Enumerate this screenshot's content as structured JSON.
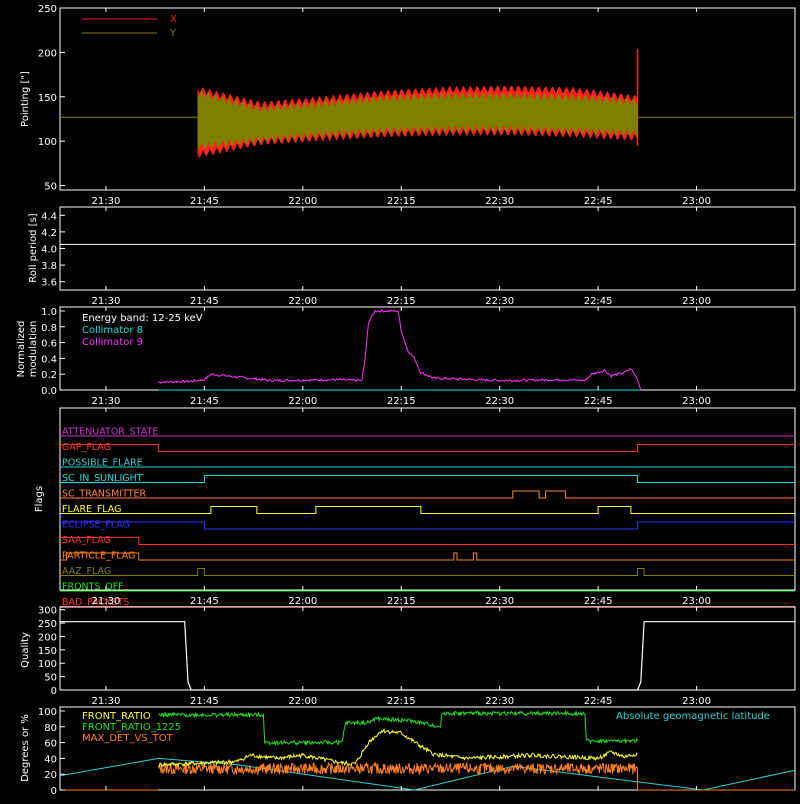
{
  "time_ticks": [
    "21:30",
    "21:45",
    "22:00",
    "22:15",
    "22:30",
    "22:45",
    "23:00"
  ],
  "time_tick_minutes": [
    1290,
    1305,
    1320,
    1335,
    1350,
    1365,
    1380
  ],
  "time_range_minutes": [
    1283,
    1395
  ],
  "colors": {
    "axis": "#ffffff",
    "x": "#ff2020",
    "y": "#808000",
    "coll8": "#00e0e0",
    "coll9": "#ff30ff",
    "front_ratio": "#ffff30",
    "front_ratio_1225": "#20e020",
    "max_det": "#ff8020",
    "geomag": "#30d0d0"
  },
  "chart_data": [
    {
      "type": "line",
      "id": "pointing",
      "ylabel": "Pointing [\"]",
      "yticks": [
        "250",
        "200",
        "150",
        "100",
        "50"
      ],
      "ytick_values": [
        250,
        200,
        150,
        100,
        50
      ],
      "ylim": [
        45,
        250
      ],
      "series": [
        {
          "name": "X",
          "color": "#ff2020",
          "start": 1304,
          "end": 1371,
          "env_low": [
            81,
            95,
            100,
            104,
            106,
            106,
            104,
            100
          ],
          "env_high": [
            162,
            145,
            151,
            158,
            162,
            163,
            161,
            152
          ],
          "spike": 204
        },
        {
          "name": "Y",
          "color": "#808000",
          "start": 1304,
          "end": 1371,
          "env_low": [
            90,
            98,
            104,
            108,
            110,
            110,
            108,
            105
          ],
          "env_high": [
            158,
            140,
            146,
            152,
            155,
            155,
            153,
            148
          ],
          "baseline": 127
        }
      ]
    },
    {
      "type": "line",
      "id": "roll",
      "ylabel": "Roll period [s]",
      "yticks": [
        "4.4",
        "4.2",
        "4.0",
        "3.8",
        "3.6"
      ],
      "ytick_values": [
        4.4,
        4.2,
        4.0,
        3.8,
        3.6
      ],
      "ylim": [
        3.5,
        4.5
      ],
      "series": [
        {
          "name": "",
          "color": "#ffffff",
          "value": 4.05
        }
      ]
    },
    {
      "type": "line",
      "id": "modulation",
      "ylabel": "Normalized modulation",
      "ylabel_lines": [
        "Normalized",
        "modulation"
      ],
      "yticks": [
        "1.0",
        "0.8",
        "0.6",
        "0.4",
        "0.2",
        "0.0"
      ],
      "ytick_values": [
        1.0,
        0.8,
        0.6,
        0.4,
        0.2,
        0.0
      ],
      "ylim": [
        0,
        1.05
      ],
      "legend": [
        "Energy band: 12-25 keV",
        "Collimator 8",
        "Collimator 9"
      ],
      "series": [
        {
          "name": "Collimator 8",
          "color": "#00e0e0",
          "value": 0.0
        },
        {
          "name": "Collimator 9",
          "color": "#ff30ff",
          "x": [
            1298,
            1303,
            1305,
            1306,
            1315,
            1325,
            1329,
            1329.5,
            1330,
            1331,
            1332,
            1334,
            1334.5,
            1335,
            1336,
            1337,
            1338,
            1340,
            1350,
            1360,
            1363,
            1364,
            1366,
            1367,
            1369,
            1370,
            1371,
            1371.5
          ],
          "y": [
            0.1,
            0.11,
            0.13,
            0.2,
            0.12,
            0.13,
            0.12,
            0.4,
            0.85,
            1.0,
            1.0,
            1.0,
            1.0,
            0.75,
            0.5,
            0.4,
            0.22,
            0.15,
            0.12,
            0.13,
            0.12,
            0.2,
            0.25,
            0.18,
            0.22,
            0.27,
            0.14,
            0.0
          ]
        }
      ]
    },
    {
      "type": "line",
      "id": "flags",
      "ylabel": "Flags",
      "flags": [
        {
          "name": "ATTENUATOR_STATE",
          "color": "#d030d0",
          "segments": [
            [
              1283,
              1395,
              0
            ]
          ]
        },
        {
          "name": "GAP_FLAG",
          "color": "#ff3030",
          "segments": [
            [
              1283,
              1298,
              1
            ],
            [
              1298,
              1371,
              0
            ],
            [
              1371,
              1395,
              1
            ]
          ]
        },
        {
          "name": "POSSIBLE_FLARE",
          "color": "#30d0d0",
          "segments": [
            [
              1283,
              1395,
              0
            ]
          ]
        },
        {
          "name": "SC_IN_SUNLIGHT",
          "color": "#00e0e0",
          "segments": [
            [
              1283,
              1305,
              0
            ],
            [
              1305,
              1371,
              1
            ],
            [
              1371,
              1395,
              0
            ]
          ]
        },
        {
          "name": "SC_TRANSMITTER",
          "color": "#ff8040",
          "segments": [
            [
              1283,
              1352,
              0
            ],
            [
              1352,
              1356,
              1
            ],
            [
              1356,
              1357,
              0
            ],
            [
              1357,
              1360,
              1
            ],
            [
              1360,
              1395,
              0
            ]
          ]
        },
        {
          "name": "FLARE_FLAG",
          "color": "#ffff30",
          "segments": [
            [
              1283,
              1306,
              0
            ],
            [
              1306,
              1313,
              1
            ],
            [
              1313,
              1322,
              0
            ],
            [
              1322,
              1338,
              1
            ],
            [
              1338,
              1365,
              0
            ],
            [
              1365,
              1370,
              1
            ],
            [
              1370,
              1395,
              0
            ]
          ]
        },
        {
          "name": "ECLIPSE_FLAG",
          "color": "#3030ff",
          "segments": [
            [
              1283,
              1305,
              1
            ],
            [
              1305,
              1371,
              0
            ],
            [
              1371,
              1395,
              1
            ]
          ]
        },
        {
          "name": "SAA_FLAG",
          "color": "#ff3030",
          "segments": [
            [
              1283,
              1295,
              1
            ],
            [
              1295,
              1395,
              0
            ]
          ]
        },
        {
          "name": "PARTICLE_FLAG",
          "color": "#ff8020",
          "segments": [
            [
              1283,
              1284,
              0
            ],
            [
              1284,
              1295,
              1
            ],
            [
              1295,
              1343,
              0
            ],
            [
              1343,
              1343.5,
              1
            ],
            [
              1343.5,
              1346,
              0
            ],
            [
              1346,
              1346.5,
              1
            ],
            [
              1346.5,
              1395,
              0
            ]
          ]
        },
        {
          "name": "AAZ_FLAG",
          "color": "#808000",
          "segments": [
            [
              1283,
              1304,
              0
            ],
            [
              1304,
              1305,
              1
            ],
            [
              1305,
              1371,
              0
            ],
            [
              1371,
              1372,
              1
            ],
            [
              1372,
              1395,
              0
            ]
          ]
        },
        {
          "name": "FRONTS_OFF",
          "color": "#20e020",
          "segments": [
            [
              1283,
              1395,
              0
            ]
          ]
        },
        {
          "name": "BAD_PACKETS",
          "color": "#ff3030",
          "segments": [
            [
              1283,
              1395,
              0
            ]
          ]
        }
      ]
    },
    {
      "type": "line",
      "id": "quality",
      "ylabel": "Quality",
      "yticks": [
        "300",
        "250",
        "200",
        "150",
        "100",
        "50",
        "0"
      ],
      "ytick_values": [
        300,
        250,
        200,
        150,
        100,
        50,
        0
      ],
      "ylim": [
        0,
        310
      ],
      "series": [
        {
          "name": "",
          "color": "#ffffff",
          "x": [
            1283,
            1302,
            1302.5,
            1303,
            1371,
            1371.5,
            1372,
            1395
          ],
          "y": [
            255,
            255,
            30,
            0,
            0,
            30,
            255,
            255
          ]
        }
      ]
    },
    {
      "type": "line",
      "id": "ratios",
      "ylabel": "Degrees or %",
      "yticks": [
        "100",
        "80",
        "60",
        "40",
        "20",
        "0"
      ],
      "ytick_values": [
        100,
        80,
        60,
        40,
        20,
        0
      ],
      "ylim": [
        0,
        105
      ],
      "legend": [
        "FRONT_RATIO",
        "FRONT_RATIO_1225",
        "MAX_DET_VS_TOT",
        "Absolute geomagnetic latitude"
      ],
      "series": [
        {
          "name": "FRONT_RATIO",
          "color": "#ffff30",
          "x": [
            1298,
            1305,
            1310,
            1312,
            1316,
            1320,
            1326,
            1328,
            1330,
            1332,
            1335,
            1338,
            1340,
            1345,
            1355,
            1365,
            1367,
            1369,
            1371
          ],
          "y": [
            32,
            34,
            36,
            44,
            40,
            44,
            34,
            33,
            60,
            75,
            72,
            55,
            45,
            40,
            44,
            40,
            48,
            42,
            46
          ]
        },
        {
          "name": "FRONT_RATIO_1225",
          "color": "#20e020",
          "x": [
            1298,
            1314,
            1314.2,
            1326,
            1326.5,
            1330,
            1331,
            1336,
            1338,
            1341,
            1341.2,
            1363,
            1363.2,
            1371
          ],
          "y": [
            95,
            95,
            60,
            60,
            85,
            85,
            90,
            88,
            85,
            80,
            97,
            97,
            62,
            62
          ]
        },
        {
          "name": "MAX_DET_VS_TOT",
          "color": "#ff8020",
          "value": 27
        },
        {
          "name": "Absolute geomagnetic latitude",
          "color": "#30d0d0",
          "x": [
            1283,
            1298,
            1310,
            1337,
            1352,
            1381,
            1395
          ],
          "y": [
            18,
            40,
            32,
            0,
            30,
            0,
            25
          ]
        }
      ]
    }
  ]
}
